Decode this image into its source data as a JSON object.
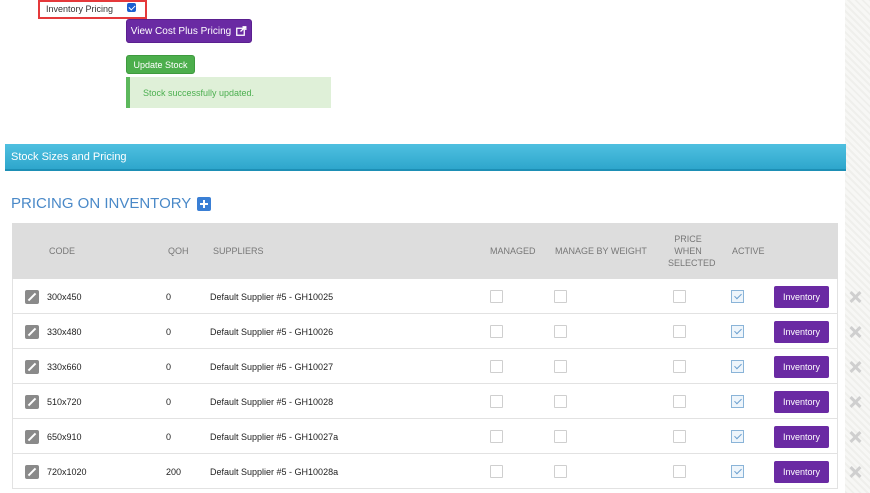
{
  "top": {
    "inventory_pricing_label": "Inventory Pricing",
    "inventory_pricing_checked": true,
    "cost_plus_button": "View Cost Plus Pricing",
    "update_stock_button": "Update Stock",
    "success_message": "Stock successfully updated."
  },
  "section": {
    "title": "Stock Sizes and Pricing"
  },
  "pricing": {
    "heading": "PRICING ON INVENTORY",
    "columns": {
      "code": "CODE",
      "qoh": "QOH",
      "suppliers": "SUPPLIERS",
      "managed": "MANAGED",
      "manage_by_weight": "MANAGE BY WEIGHT",
      "price_when_selected_1": "PRICE",
      "price_when_selected_2": "WHEN",
      "price_when_selected_3": "SELECTED",
      "active": "ACTIVE"
    },
    "inventory_button": "Inventory",
    "rows": [
      {
        "code": "300x450",
        "qoh": "0",
        "supplier": "Default Supplier #5 - GH10025",
        "managed": false,
        "by_weight": false,
        "price_selected": false,
        "active": true
      },
      {
        "code": "330x480",
        "qoh": "0",
        "supplier": "Default Supplier #5 - GH10026",
        "managed": false,
        "by_weight": false,
        "price_selected": false,
        "active": true
      },
      {
        "code": "330x660",
        "qoh": "0",
        "supplier": "Default Supplier #5 - GH10027",
        "managed": false,
        "by_weight": false,
        "price_selected": false,
        "active": true
      },
      {
        "code": "510x720",
        "qoh": "0",
        "supplier": "Default Supplier #5 - GH10028",
        "managed": false,
        "by_weight": false,
        "price_selected": false,
        "active": true
      },
      {
        "code": "650x910",
        "qoh": "0",
        "supplier": "Default Supplier #5 - GH10027a",
        "managed": false,
        "by_weight": false,
        "price_selected": false,
        "active": true
      },
      {
        "code": "720x1020",
        "qoh": "200",
        "supplier": "Default Supplier #5 - GH10028a",
        "managed": false,
        "by_weight": false,
        "price_selected": false,
        "active": true
      }
    ]
  },
  "colors": {
    "purple": "#6a2aa3",
    "green": "#4cae4c",
    "section_blue": "#2ea6cc",
    "heading_blue": "#4a89c8",
    "highlight_red": "#e5393b"
  }
}
